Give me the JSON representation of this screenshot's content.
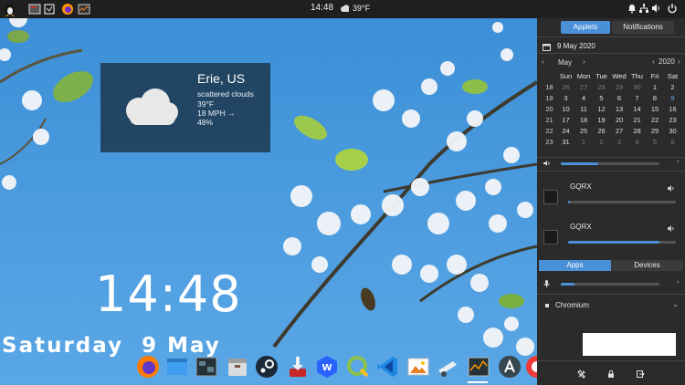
{
  "top_panel": {
    "clock": "14:48",
    "weather_temp": "39°F",
    "icons": [
      "menu-tux-icon",
      "terminal-icon",
      "screenshot-icon",
      "firefox-icon",
      "system-monitor-icon",
      "notification-bell-icon",
      "network-icon",
      "volume-icon",
      "power-icon"
    ]
  },
  "weather": {
    "city": "Erie, US",
    "condition": "scattered clouds",
    "temperature": "39°F",
    "wind": "18 MPH →",
    "humidity": "48%"
  },
  "desktop_clock": {
    "time": "14:48",
    "date": "Saturday  9 May"
  },
  "dock": {
    "apps": [
      "firefox",
      "files",
      "terminal",
      "archive",
      "steam",
      "software-install",
      "wps-writer",
      "qgis",
      "vscode",
      "image-viewer",
      "kstars",
      "system-monitor",
      "app-store",
      "vivaldi"
    ]
  },
  "sidebar": {
    "tabs": {
      "applets": "Applets",
      "notifications": "Notifications"
    },
    "calendar": {
      "date_label": "9 May 2020",
      "month": "May",
      "year": "2020",
      "weekdays": [
        "Sun",
        "Mon",
        "Tue",
        "Wed",
        "Thu",
        "Fri",
        "Sat"
      ],
      "weeks": [
        {
          "num": "18",
          "days": [
            "26",
            "27",
            "28",
            "29",
            "30",
            "1",
            "2"
          ]
        },
        {
          "num": "19",
          "days": [
            "3",
            "4",
            "5",
            "6",
            "7",
            "8",
            "9"
          ]
        },
        {
          "num": "20",
          "days": [
            "10",
            "11",
            "12",
            "13",
            "14",
            "15",
            "16"
          ]
        },
        {
          "num": "21",
          "days": [
            "17",
            "18",
            "19",
            "20",
            "21",
            "22",
            "23"
          ]
        },
        {
          "num": "22",
          "days": [
            "24",
            "25",
            "26",
            "27",
            "28",
            "29",
            "30"
          ]
        },
        {
          "num": "23",
          "days": [
            "31",
            "1",
            "2",
            "3",
            "4",
            "5",
            "6"
          ]
        }
      ],
      "today": "9"
    },
    "master_volume": 0.38,
    "streams": [
      {
        "name": "GQRX",
        "volume": 0.0
      },
      {
        "name": "GQRX",
        "volume": 0.85
      }
    ],
    "apps_tabs": {
      "apps": "Apps",
      "devices": "Devices"
    },
    "mic_volume": 0.14,
    "window_name": "Chromium"
  }
}
